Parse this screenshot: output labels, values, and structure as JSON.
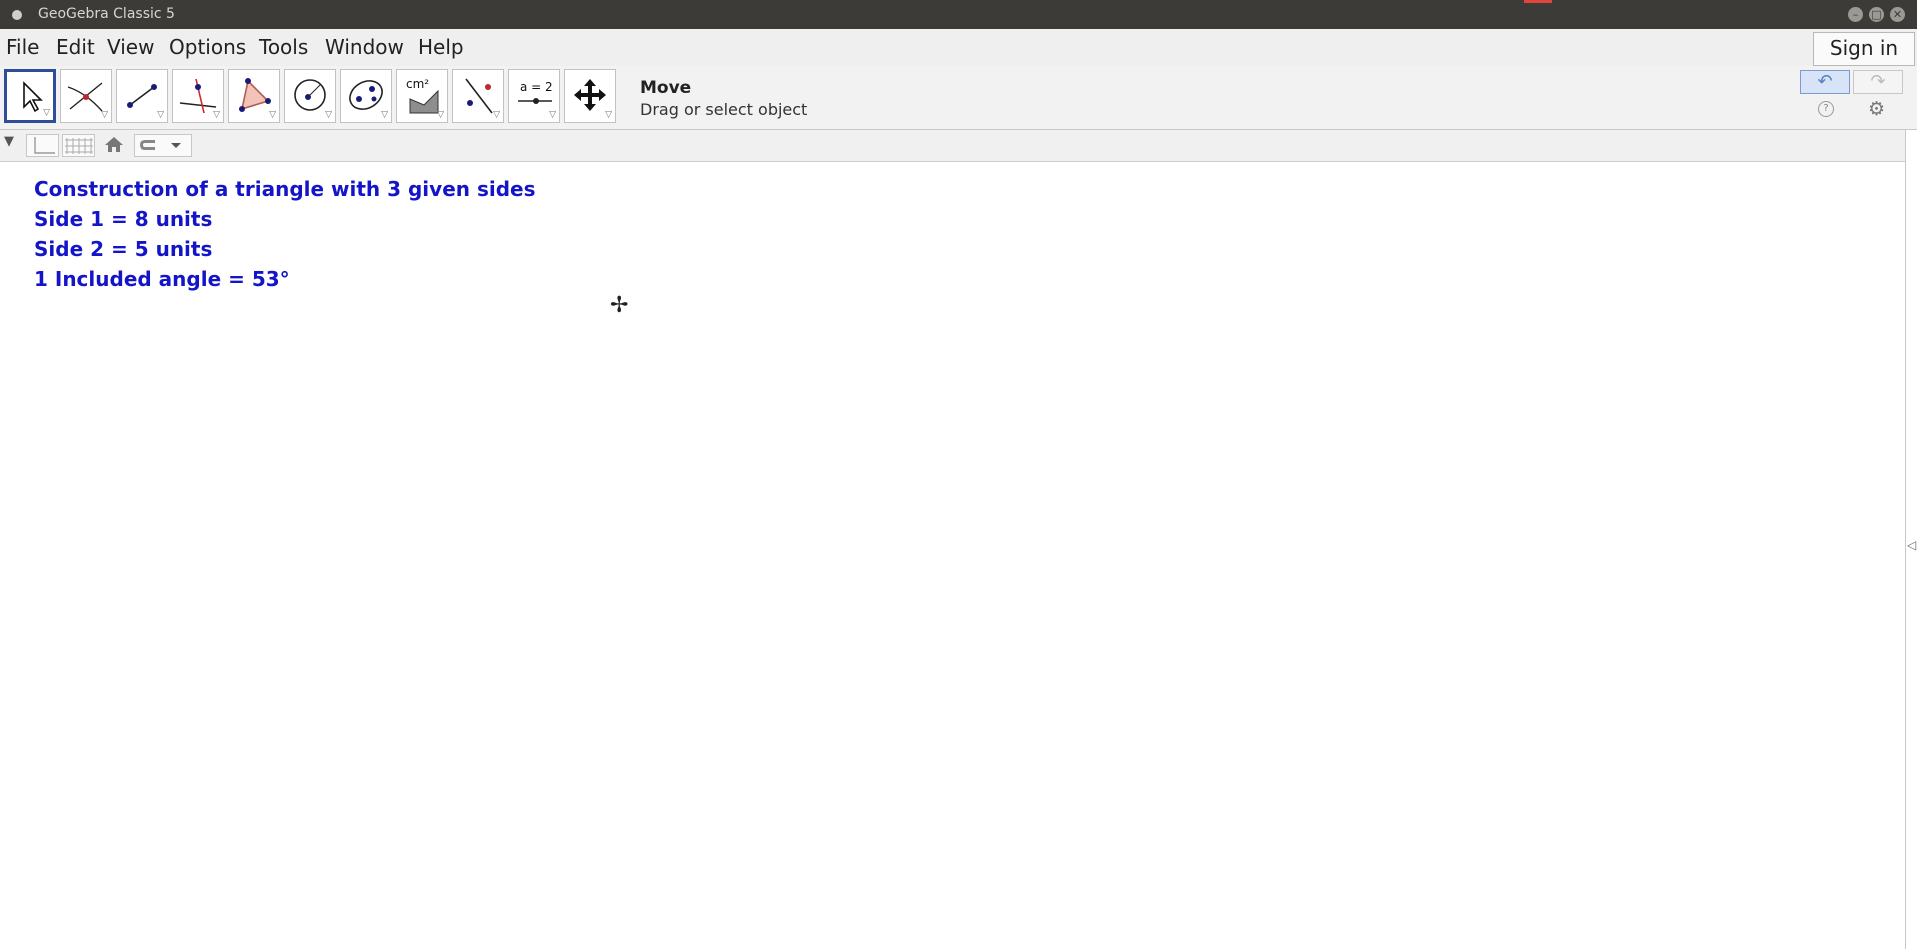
{
  "window": {
    "title": "GeoGebra Classic 5",
    "controls": [
      "–",
      "□",
      "✕"
    ]
  },
  "menubar": {
    "items": [
      "File",
      "Edit",
      "View",
      "Options",
      "Tools",
      "Window",
      "Help"
    ],
    "signin": "Sign in"
  },
  "toolbar": {
    "tools": [
      {
        "name": "move-tool",
        "active": true
      },
      {
        "name": "point-tool"
      },
      {
        "name": "line-tool"
      },
      {
        "name": "perpendicular-tool"
      },
      {
        "name": "polygon-tool"
      },
      {
        "name": "circle-tool"
      },
      {
        "name": "conic-tool"
      },
      {
        "name": "measure-tool",
        "label": "cm²"
      },
      {
        "name": "reflect-tool"
      },
      {
        "name": "slider-tool",
        "label": "a = 2"
      },
      {
        "name": "move-view-tool"
      }
    ],
    "current_tool_name": "Move",
    "current_tool_help": "Drag or select object",
    "undo": "↶",
    "redo": "↷"
  },
  "graphics": {
    "lines": [
      "Construction of a triangle with 3 given sides",
      "Side 1 = 8 units",
      "Side 2 = 5 units",
      "1 Included angle = 53°"
    ],
    "text_color": "#1414c8"
  }
}
